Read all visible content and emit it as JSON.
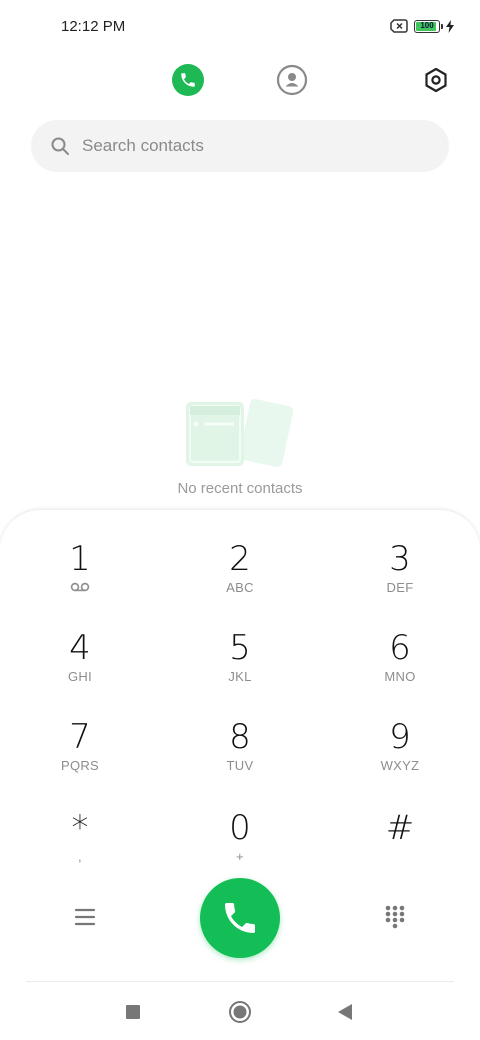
{
  "status_bar": {
    "time": "12:12 PM",
    "battery_level": 100,
    "battery_label": "100",
    "icons": [
      "no-sim-icon",
      "battery-icon",
      "charging-bolt-icon"
    ]
  },
  "top_nav": {
    "items": [
      {
        "icon": "phone-icon",
        "active": true
      },
      {
        "icon": "contacts-icon",
        "active": false
      },
      {
        "icon": "settings-icon",
        "active": false
      }
    ],
    "accent": "#1eb854"
  },
  "search": {
    "placeholder": "Search contacts",
    "icon": "search-icon"
  },
  "recents": {
    "empty_text": "No recent contacts",
    "illustration": "empty-recents-illustration"
  },
  "dialpad": {
    "keys": [
      {
        "digit": "1",
        "letters": "",
        "icon": "voicemail-icon"
      },
      {
        "digit": "2",
        "letters": "ABC"
      },
      {
        "digit": "3",
        "letters": "DEF"
      },
      {
        "digit": "4",
        "letters": "GHI"
      },
      {
        "digit": "5",
        "letters": "JKL"
      },
      {
        "digit": "6",
        "letters": "MNO"
      },
      {
        "digit": "7",
        "letters": "PQRS"
      },
      {
        "digit": "8",
        "letters": "TUV"
      },
      {
        "digit": "9",
        "letters": "WXYZ"
      },
      {
        "digit": "*",
        "letters": ","
      },
      {
        "digit": "0",
        "letters": "+"
      },
      {
        "digit": "#",
        "letters": ""
      }
    ],
    "bottom": {
      "left_icon": "menu-icon",
      "center_icon": "call-icon",
      "right_icon": "dialpad-icon",
      "call_color": "#13be57"
    }
  },
  "system_nav": {
    "icons": [
      "recents-square-icon",
      "home-circle-icon",
      "back-triangle-icon"
    ]
  }
}
